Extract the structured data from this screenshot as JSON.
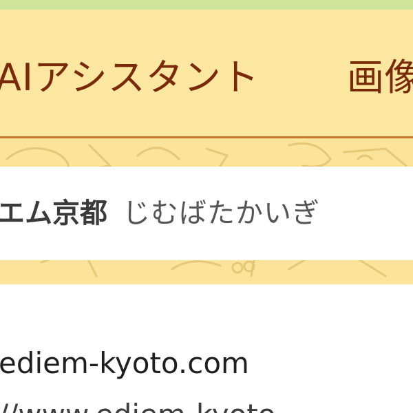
{
  "tabs": {
    "ai_assistant": "AIアシスタント",
    "images": "画像"
  },
  "search": {
    "query_main": "エム京都",
    "query_reading": "じむばたかいぎ"
  },
  "result": {
    "domain": "ediem-kyoto.com",
    "url": "//www.ediem-kyoto"
  },
  "colors": {
    "tab_background": "#fbe7a0",
    "tab_text": "#7a2a0a",
    "tab_underline": "#c6762c",
    "top_strip": "#cfe49a"
  }
}
